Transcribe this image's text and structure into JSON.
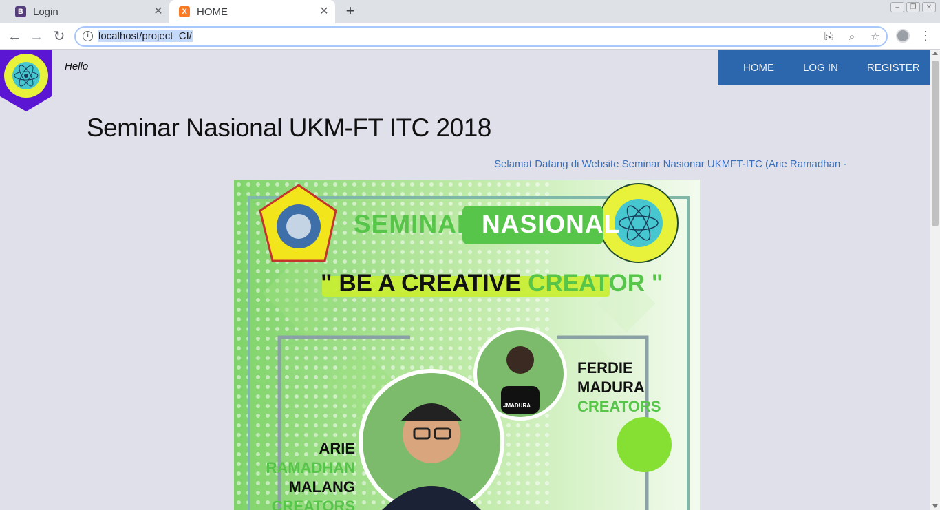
{
  "browser": {
    "tabs": [
      {
        "title": "Login",
        "favicon": "B"
      },
      {
        "title": "HOME",
        "favicon": "X"
      }
    ],
    "url": "localhost/project_CI/"
  },
  "header": {
    "greeting": "Hello",
    "nav": [
      {
        "label": "HOME"
      },
      {
        "label": "LOG IN"
      },
      {
        "label": "REGISTER"
      }
    ]
  },
  "main": {
    "title": "Seminar Nasional UKM-FT ITC 2018",
    "marquee": "Selamat Datang di Website Seminar Nasionar UKMFT-ITC (Arie Ramadhan -"
  },
  "poster": {
    "heading_left": "SEMINAR",
    "heading_right": "NASIONAL",
    "tagline_black": "\" BE A CREATIVE",
    "tagline_green": "CREATOR \"",
    "speaker1_name": "FERDIE",
    "speaker1_city": "MADURA",
    "speaker1_group": "CREATORS",
    "speaker2_first": "ARIE",
    "speaker2_last": "RAMADHAN",
    "speaker2_city": "MALANG",
    "speaker2_group": "CREATORS",
    "shirt_text": "#MADURA"
  },
  "colors": {
    "nav_bg": "#2c67ad",
    "poster_green": "#57c54a",
    "link_blue": "#3b6fb8",
    "shield_purple": "#5b16d4"
  }
}
